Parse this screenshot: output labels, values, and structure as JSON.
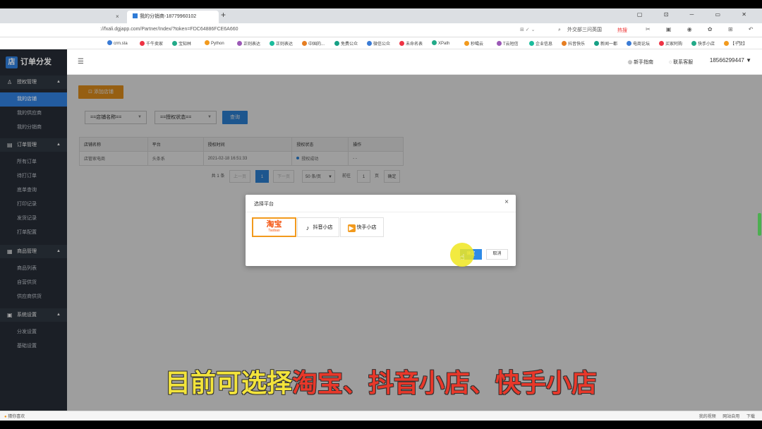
{
  "browser": {
    "tabs": [
      {
        "label": ""
      },
      {
        "label": "我的分销商-18779960102"
      }
    ],
    "new_tab": "+",
    "url": "://fxali.dgjapp.com/Partner/Index/?token=FDC64886FCE6A660",
    "search_text": "外交部三问英国",
    "hot_label": "热搜",
    "bookmarks": [
      "crm.sta",
      "千牛卖家",
      "宝知林",
      "Python",
      "正则表达",
      "正则表达",
      "中国的...",
      "免费公众",
      "微信公众",
      "未命名表",
      "XPath",
      "秒噶云",
      "T云短信",
      "企业信息",
      "抖音快乐",
      "新闻一都",
      "电商论坛",
      "买家阿购",
      "快手小店",
      "【千货】"
    ],
    "more": "»"
  },
  "sidebar": {
    "logo_mark": "店",
    "logo_text": "订单分发",
    "groups": [
      {
        "label": "授权管理",
        "items": [
          "我的店铺",
          "我的供应商",
          "我的分销商"
        ]
      },
      {
        "label": "订单管理",
        "items": [
          "所有订单",
          "待打订单",
          "底单查询",
          "打印记录",
          "发货记录",
          "打单配置"
        ]
      },
      {
        "label": "商品管理",
        "items": [
          "商品列表",
          "自营供货",
          "供应商供货"
        ]
      },
      {
        "label": "系统设置",
        "items": [
          "分发设置",
          "基础设置"
        ]
      }
    ]
  },
  "header": {
    "menu_icon": "☰",
    "guide": "新手指南",
    "service": "联系客服",
    "phone": "18566299447 ▼"
  },
  "content": {
    "add_shop": "添加店铺",
    "filter_shop": "==店铺名称==",
    "filter_status": "==授权状态==",
    "query": "查询",
    "table": {
      "headers": [
        "店铺名称",
        "平台",
        "授权时间",
        "授权状态",
        "操作"
      ],
      "rows": [
        [
          "店管家电商",
          "头条系",
          "2021-02-18 16:51:33",
          "授权成功",
          "- -"
        ]
      ]
    },
    "pager": {
      "total": "共 1 条",
      "prev": "上一页",
      "current": "1",
      "next": "下一页",
      "page_size": "50 条/页",
      "goto": "前往",
      "goto_value": "1",
      "page_unit": "页",
      "confirm": "确定"
    }
  },
  "modal": {
    "title": "选择平台",
    "close": "×",
    "platforms": [
      {
        "name": "淘宝",
        "sub": "Taobao"
      },
      {
        "name": "抖音小店"
      },
      {
        "name": "快手小店"
      }
    ],
    "ok": "确定",
    "cancel": "取消"
  },
  "caption": {
    "part1": "目前可选择",
    "part2": "淘宝、抖音小店、快手小店"
  },
  "statusbar": {
    "left": "猜你喜欢",
    "right": [
      "我的视频",
      "网站自用",
      "下载"
    ]
  },
  "colors": {
    "sidebar": "#242a33",
    "primary": "#2f8be6",
    "orange": "#f29a1d",
    "caption_yellow": "#f3e43c",
    "caption_red": "#e8382a"
  }
}
